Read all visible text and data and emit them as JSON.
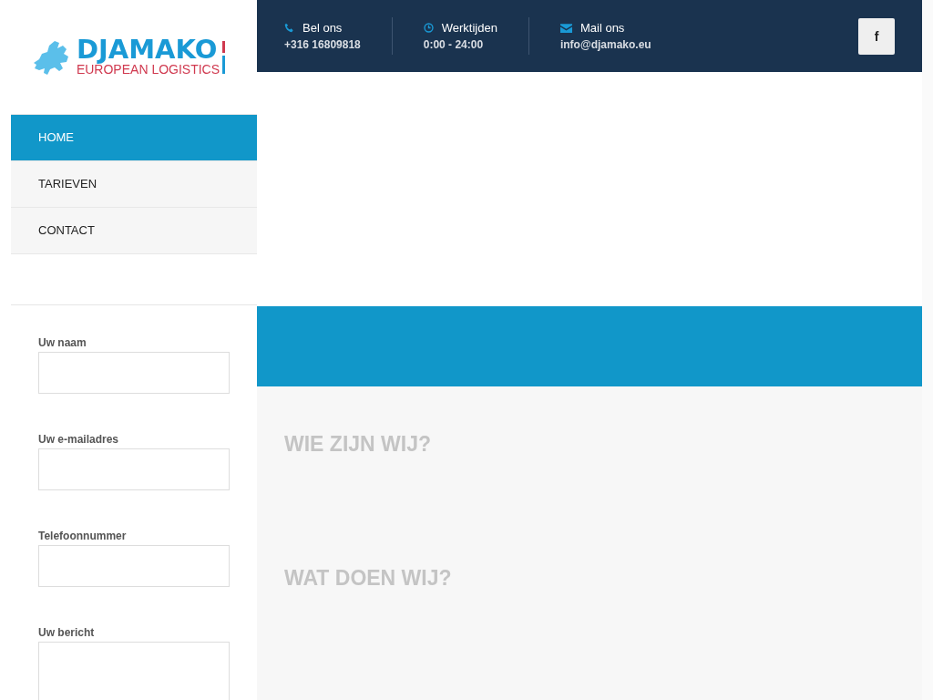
{
  "logo": {
    "name": "DJAMAKO",
    "tagline": "EUROPEAN LOGISTICS"
  },
  "nav": [
    {
      "label": "HOME",
      "selected": true
    },
    {
      "label": "TARIEVEN",
      "selected": false
    },
    {
      "label": "CONTACT",
      "selected": false
    }
  ],
  "form": {
    "fields": [
      {
        "label": "Uw naam",
        "kind": "input"
      },
      {
        "label": "Uw e-mailadres",
        "kind": "input"
      },
      {
        "label": "Telefoonnummer",
        "kind": "input"
      },
      {
        "label": "Uw bericht",
        "kind": "textarea"
      }
    ]
  },
  "topbar": {
    "items": [
      {
        "title": "Bel ons",
        "value": "+316 16809818"
      },
      {
        "title": "Werktijden",
        "value": "0:00 - 24:00"
      },
      {
        "title": "Mail ons",
        "value": "info@djamako.eu"
      }
    ],
    "social": [
      {
        "label": "f"
      }
    ]
  },
  "sections": [
    {
      "heading": "WIE ZIJN WIJ?"
    },
    {
      "heading": "WAT DOEN WIJ?"
    }
  ]
}
